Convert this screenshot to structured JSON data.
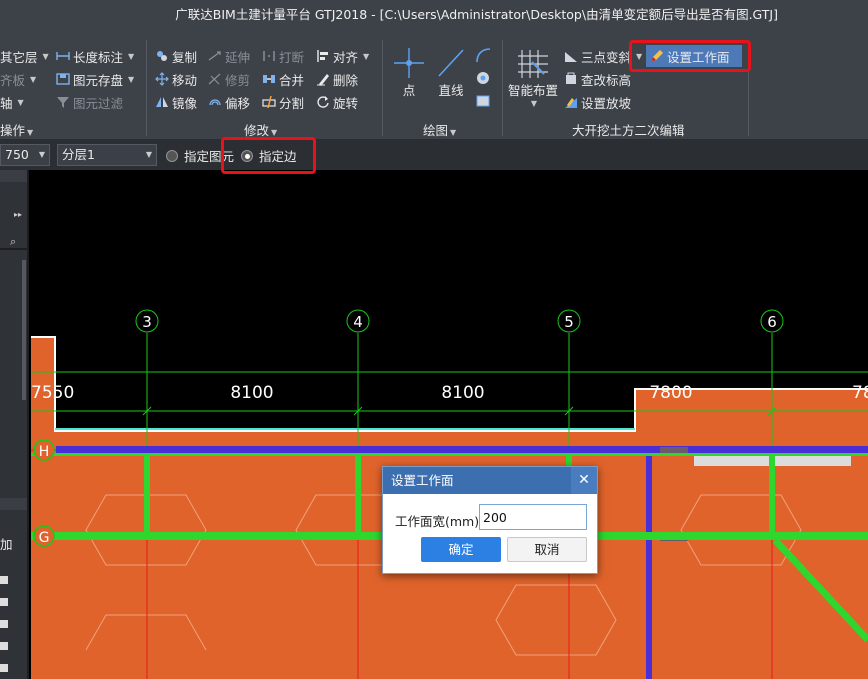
{
  "window": {
    "title": "广联达BIM土建计量平台 GTJ2018 - [C:\\Users\\Administrator\\Desktop\\由清单变定额后导出是否有图.GTJ]"
  },
  "ribbon": {
    "col1": [
      "其它层",
      "齐板",
      "轴"
    ],
    "col1_footer": "操作",
    "col2": [
      "长度标注",
      "图元存盘",
      "图元过滤"
    ],
    "modify": {
      "copy": "复制",
      "extend": "延伸",
      "break": "打断",
      "align": "对齐",
      "move": "移动",
      "trim": "修剪",
      "merge": "合并",
      "delete": "删除",
      "mirror": "镜像",
      "offset": "偏移",
      "split": "分割",
      "rotate": "旋转",
      "label": "修改"
    },
    "draw": {
      "point": "点",
      "line": "直线",
      "label": "绘图"
    },
    "excavation": {
      "smart_layout": "智能布置",
      "three_point_slope": "三点变斜",
      "set_work_face": "设置工作面",
      "check_elevation": "查改标高",
      "set_slope": "设置放坡",
      "label": "大开挖土方二次编辑"
    }
  },
  "options": {
    "floor_value": "750",
    "layer_value": "分层1",
    "radio_element": "指定图元",
    "radio_edge": "指定边",
    "selected": "指定边"
  },
  "canvas": {
    "axis_top": [
      "3",
      "4",
      "5",
      "6"
    ],
    "axis_left": [
      "H",
      "G"
    ],
    "dimensions": [
      "7550",
      "8100",
      "8100",
      "7800",
      "78"
    ],
    "colors": {
      "soil": "#e0632b",
      "axis": "#19c719",
      "beam": "#4a2fd6",
      "gridline": "#e81b1b"
    }
  },
  "left_panel": {
    "label_add": "加"
  },
  "dialog": {
    "title": "设置工作面",
    "field_label": "工作面宽(mm)",
    "field_value": "200",
    "ok": "确定",
    "cancel": "取消"
  }
}
